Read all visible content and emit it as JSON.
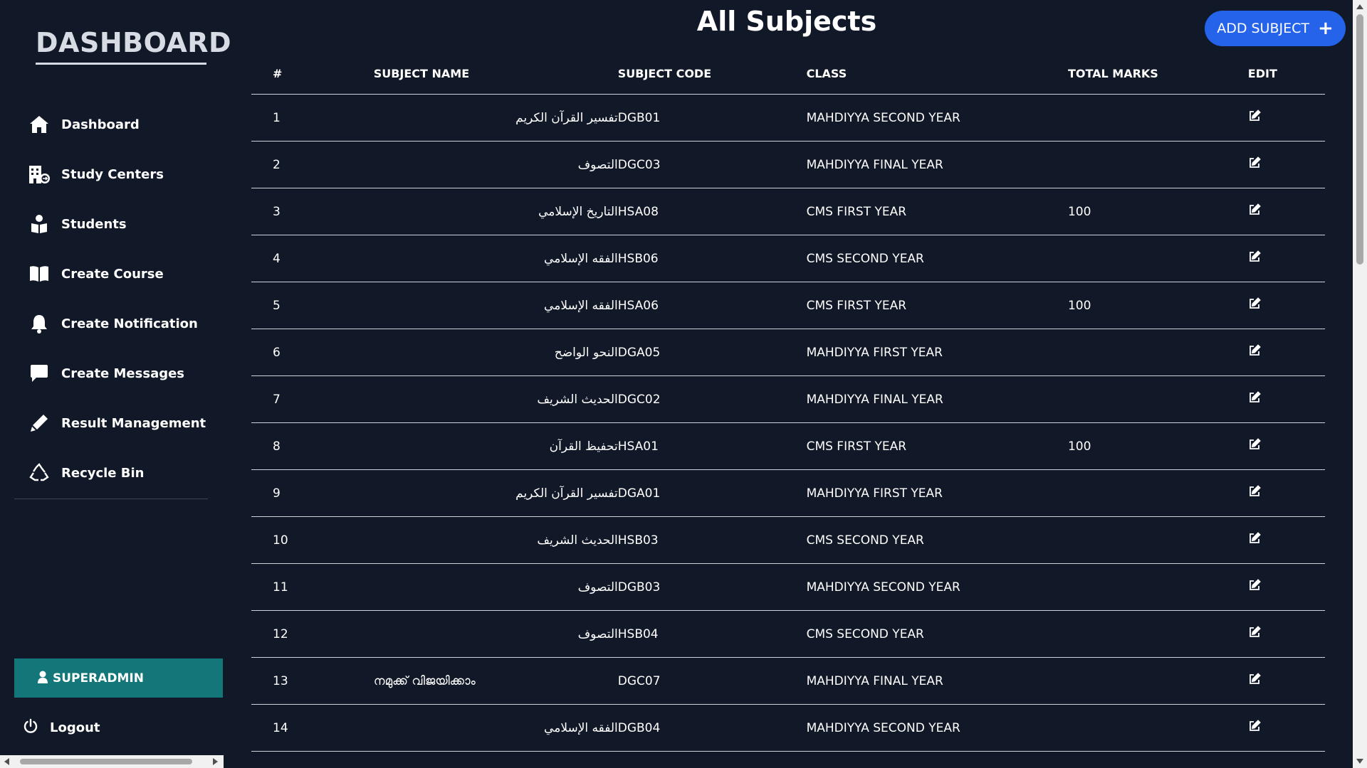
{
  "sidebar": {
    "brand": "DASHBOARD",
    "items": [
      {
        "label": "Dashboard",
        "icon": "home-icon"
      },
      {
        "label": "Study Centers",
        "icon": "building-icon"
      },
      {
        "label": "Students",
        "icon": "students-icon"
      },
      {
        "label": "Create Course",
        "icon": "book-icon"
      },
      {
        "label": "Create Notification",
        "icon": "bell-icon"
      },
      {
        "label": "Create Messages",
        "icon": "message-icon"
      },
      {
        "label": "Result Management",
        "icon": "pen-icon"
      },
      {
        "label": "Recycle Bin",
        "icon": "recycle-icon"
      }
    ],
    "user": {
      "label": "SUPERADMIN",
      "icon": "user-icon"
    },
    "logout": {
      "label": "Logout",
      "icon": "power-icon"
    }
  },
  "main": {
    "title": "All Subjects",
    "add_button": {
      "label": "ADD SUBJECT",
      "icon": "plus-icon"
    },
    "columns": [
      "#",
      "SUBJECT NAME",
      "SUBJECT CODE",
      "CLASS",
      "TOTAL MARKS",
      "EDIT"
    ],
    "rows": [
      {
        "num": "1",
        "name": "تفسير القرآن الكريم",
        "code": "DGB01",
        "class": "MAHDIYYA SECOND YEAR",
        "marks": ""
      },
      {
        "num": "2",
        "name": "التصوف",
        "code": "DGC03",
        "class": "MAHDIYYA FINAL YEAR",
        "marks": ""
      },
      {
        "num": "3",
        "name": "التاريخ الإسلامي",
        "code": "HSA08",
        "class": "CMS FIRST YEAR",
        "marks": "100"
      },
      {
        "num": "4",
        "name": "الفقه الإسلامي",
        "code": "HSB06",
        "class": "CMS SECOND YEAR",
        "marks": ""
      },
      {
        "num": "5",
        "name": "الفقه الإسلامي",
        "code": "HSA06",
        "class": "CMS FIRST YEAR",
        "marks": "100"
      },
      {
        "num": "6",
        "name": "النحو الواضح",
        "code": "DGA05",
        "class": "MAHDIYYA FIRST YEAR",
        "marks": ""
      },
      {
        "num": "7",
        "name": "الحديث الشريف",
        "code": "DGC02",
        "class": "MAHDIYYA FINAL YEAR",
        "marks": ""
      },
      {
        "num": "8",
        "name": "تحفيظ القرآن",
        "code": "HSA01",
        "class": "CMS FIRST YEAR",
        "marks": "100"
      },
      {
        "num": "9",
        "name": "تفسير القرآن الكريم",
        "code": "DGA01",
        "class": "MAHDIYYA FIRST YEAR",
        "marks": ""
      },
      {
        "num": "10",
        "name": "الحديث الشريف",
        "code": "HSB03",
        "class": "CMS SECOND YEAR",
        "marks": ""
      },
      {
        "num": "11",
        "name": "التصوف",
        "code": "DGB03",
        "class": "MAHDIYYA SECOND YEAR",
        "marks": ""
      },
      {
        "num": "12",
        "name": "التصوف",
        "code": "HSB04",
        "class": "CMS SECOND YEAR",
        "marks": ""
      },
      {
        "num": "13",
        "name": "നമുക്ക് വിജയിക്കാം",
        "code": "DGC07",
        "class": "MAHDIYYA FINAL YEAR",
        "marks": ""
      },
      {
        "num": "14",
        "name": "الفقه الإسلامي",
        "code": "DGB04",
        "class": "MAHDIYYA SECOND YEAR",
        "marks": ""
      }
    ]
  },
  "colors": {
    "background": "#111827",
    "accent": "#2563eb",
    "user_box": "#13777a"
  }
}
